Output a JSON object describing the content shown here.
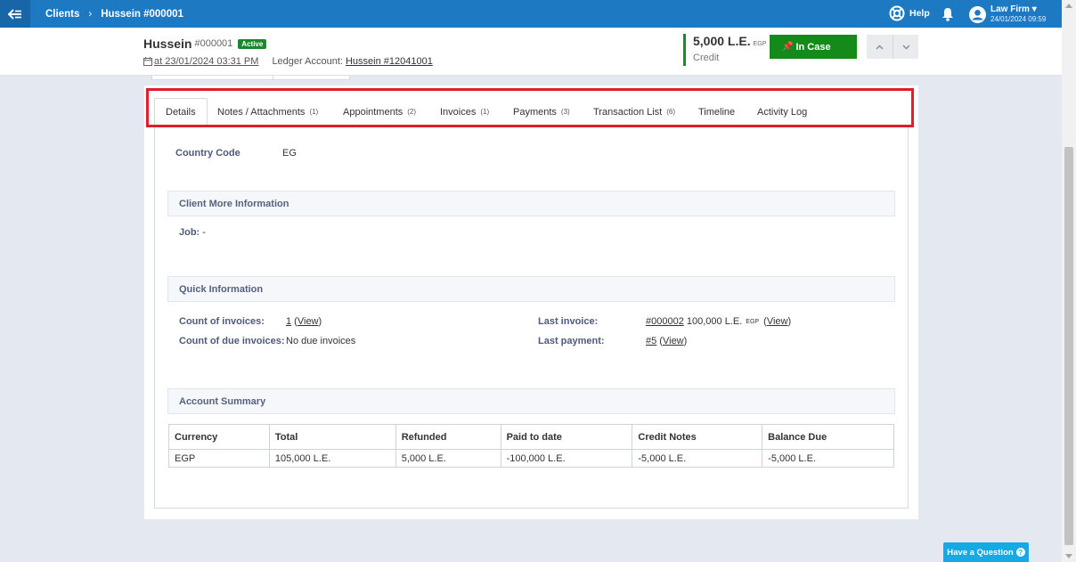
{
  "topbar": {
    "breadcrumb": [
      "Clients",
      "Hussein #000001"
    ],
    "help_label": "Help",
    "user": {
      "firm": "Law Firm",
      "datetime": "24/01/2024 09:59"
    }
  },
  "client": {
    "name": "Hussein",
    "number": "#000001",
    "status": "Active",
    "created": "at 23/01/2024 03:31 PM",
    "ledger_label": "Ledger Account:",
    "ledger_link": "Hussein #12041001"
  },
  "balance": {
    "amount": "5,000 L.E.",
    "currency": "EGP",
    "label": "Credit"
  },
  "actions": {
    "status_button": "In Case"
  },
  "tabs": [
    {
      "label": "Details",
      "count": ""
    },
    {
      "label": "Notes / Attachments",
      "count": "(1)"
    },
    {
      "label": "Appointments",
      "count": "(2)"
    },
    {
      "label": "Invoices",
      "count": "(1)"
    },
    {
      "label": "Payments",
      "count": "(3)"
    },
    {
      "label": "Transaction List",
      "count": "(6)"
    },
    {
      "label": "Timeline",
      "count": ""
    },
    {
      "label": "Activity Log",
      "count": ""
    }
  ],
  "details": {
    "country_code_label": "Country Code",
    "country_code_value": "EG"
  },
  "more_info": {
    "title": "Client More Information",
    "job_label": "Job:",
    "job_value": "-"
  },
  "quick_info": {
    "title": "Quick Information",
    "count_invoices_label": "Count of invoices:",
    "count_invoices_value": "1",
    "view_label": "View",
    "count_due_label": "Count of due invoices:",
    "count_due_value": "No due invoices",
    "last_invoice_label": "Last invoice:",
    "last_invoice_link": "#000002",
    "last_invoice_amount": "100,000 L.E.",
    "last_invoice_currency": "EGP",
    "last_payment_label": "Last payment:",
    "last_payment_link": "#5"
  },
  "account_summary": {
    "title": "Account Summary",
    "columns": [
      "Currency",
      "Total",
      "Refunded",
      "Paid to date",
      "Credit Notes",
      "Balance Due"
    ],
    "rows": [
      [
        "EGP",
        "105,000 L.E.",
        "5,000 L.E.",
        "-100,000 L.E.",
        "-5,000 L.E.",
        "-5,000 L.E."
      ]
    ]
  },
  "support": {
    "label": "Have a Question"
  },
  "colors": {
    "brand": "#1e79c3",
    "success": "#148a1a",
    "highlight": "#e11d2d",
    "support": "#16a9e6"
  }
}
